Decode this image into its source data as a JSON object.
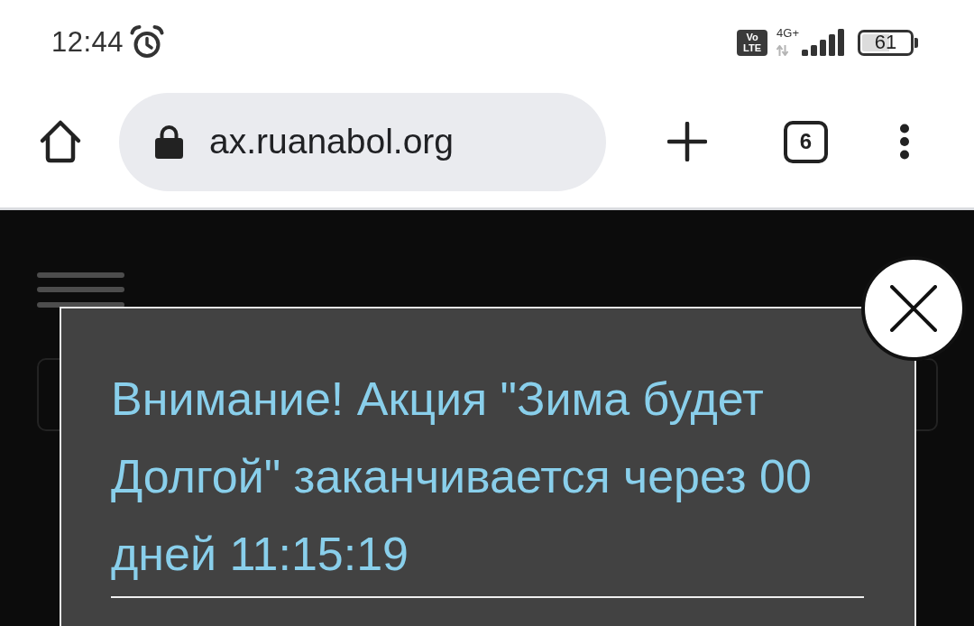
{
  "status_bar": {
    "time": "12:44",
    "volte_badge": [
      "Vo",
      "LTE"
    ],
    "network": "4G+",
    "battery": "61"
  },
  "browser_toolbar": {
    "url": "ax.ruanabol.org",
    "tab_count": "6"
  },
  "popup": {
    "message": "Внимание! Акция \"Зима будет Долгой\" заканчивается через 00 дней 11:15:19"
  }
}
